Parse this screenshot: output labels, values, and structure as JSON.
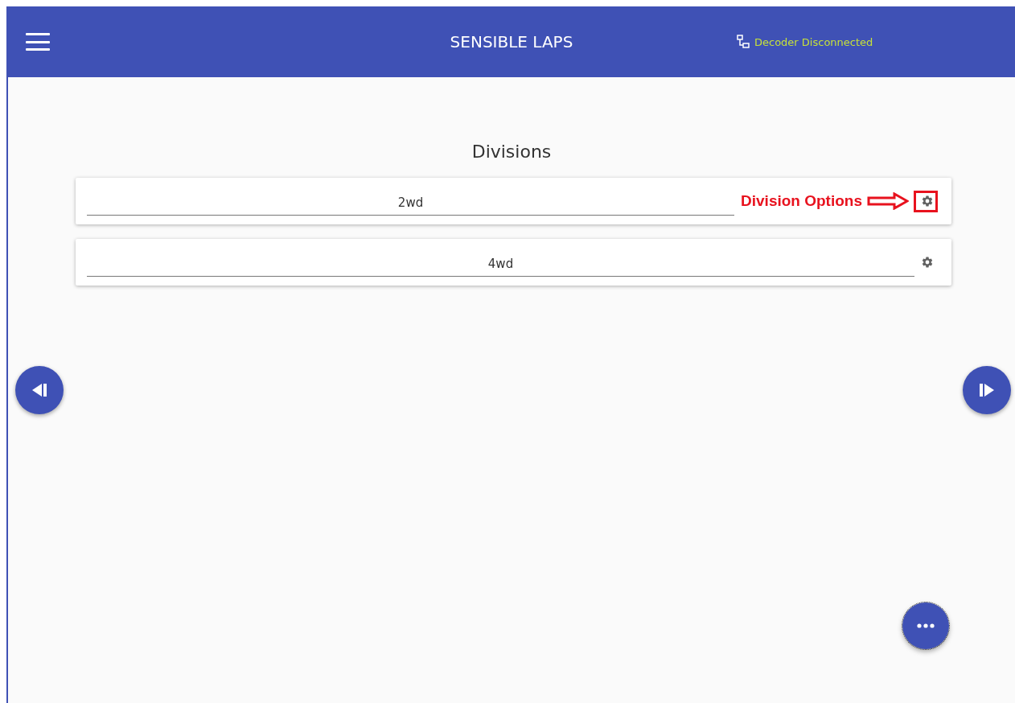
{
  "app_bar": {
    "title": "SENSIBLE LAPS",
    "decoder_status": "Decoder Disconnected"
  },
  "heading": "Divisions",
  "divisions": [
    {
      "name": "2wd",
      "annotation": "Division Options"
    },
    {
      "name": "4wd"
    }
  ]
}
